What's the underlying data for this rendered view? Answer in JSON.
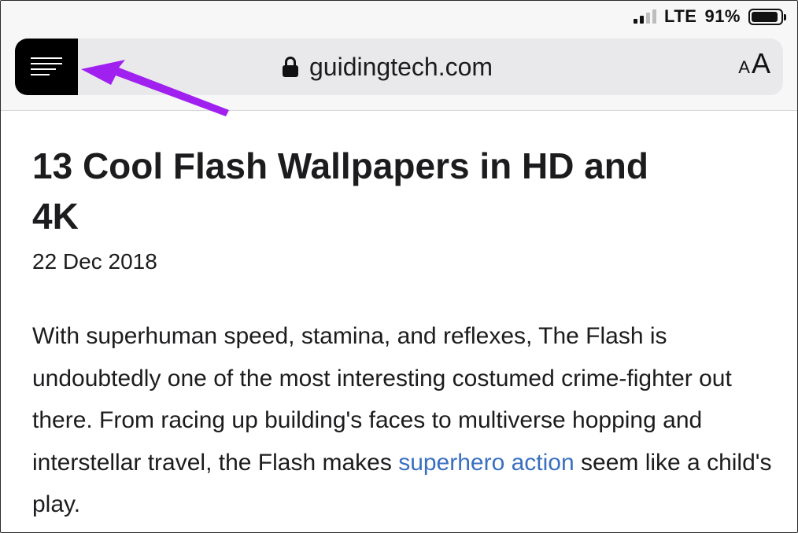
{
  "status_bar": {
    "network": "LTE",
    "battery_percent": "91%",
    "battery_level": 0.91,
    "signal_bars_on": 2,
    "signal_bars_total": 4
  },
  "address_bar": {
    "menu_icon": "reader-view-icon",
    "lock_icon": "lock-icon",
    "url": "guidingtech.com",
    "text_size_small": "A",
    "text_size_large": "A"
  },
  "annotation": {
    "arrow_color": "#a020f0"
  },
  "article": {
    "title": "13 Cool Flash Wallpapers in HD and 4K",
    "date": "22 Dec 2018",
    "body_before_link": "With superhuman speed, stamina, and reflexes, The Flash is undoubtedly one of the most interesting costumed crime-fighter out there. From racing up building's faces to multiverse hopping and interstellar travel, the Flash makes ",
    "link_text": "superhero action",
    "body_after_link": " seem like a child's play.",
    "link_color": "#3a6fc1"
  }
}
